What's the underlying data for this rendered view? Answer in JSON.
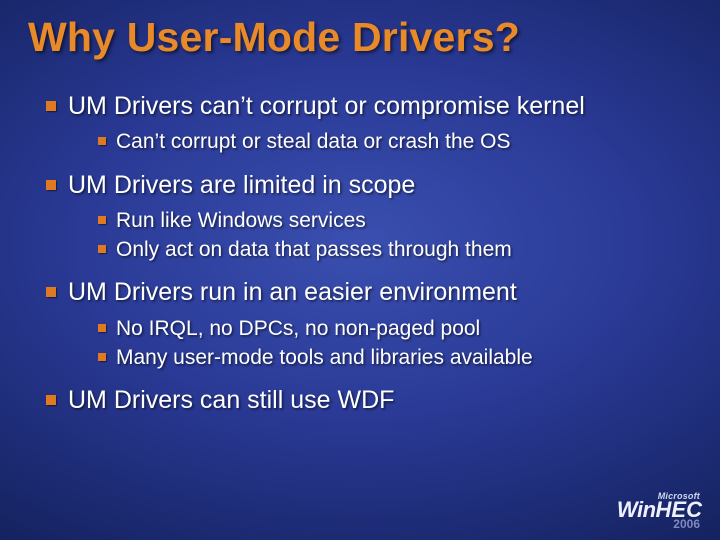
{
  "title": "Why User-Mode Drivers?",
  "bullets": [
    {
      "text": "UM Drivers can’t corrupt or compromise kernel",
      "sub": [
        "Can’t corrupt or steal data or crash the OS"
      ]
    },
    {
      "text": "UM Drivers are limited in scope",
      "sub": [
        "Run like Windows services",
        "Only act on data that passes through them"
      ]
    },
    {
      "text": "UM Drivers run in an easier environment",
      "sub": [
        "No IRQL, no DPCs, no non-paged pool",
        "Many user-mode tools and libraries available"
      ]
    },
    {
      "text": "UM Drivers can still use WDF",
      "sub": []
    }
  ],
  "logo": {
    "vendor": "Microsoft",
    "product_a": "Win",
    "product_b": "HEC",
    "year": "2006"
  }
}
